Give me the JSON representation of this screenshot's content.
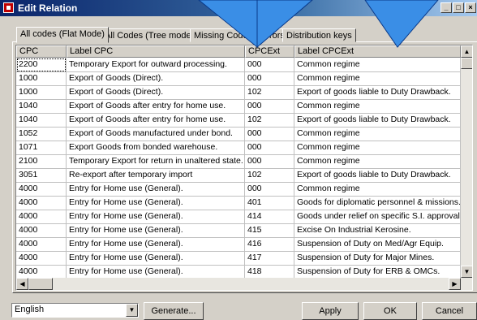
{
  "window": {
    "title": "Edit Relation",
    "icon": "app-flag-icon"
  },
  "tabs": [
    {
      "label": "All codes (Flat Mode)",
      "active": true
    },
    {
      "label": "All Codes (Tree mode)",
      "active": false
    },
    {
      "label": "Missing Codes",
      "active": false
    },
    {
      "label": "Errors",
      "active": false
    },
    {
      "label": "Distribution keys",
      "active": false
    }
  ],
  "grid": {
    "columns": [
      "CPC",
      "Label CPC",
      "CPCExt",
      "Label CPCExt"
    ],
    "rows": [
      [
        "2200",
        "Temporary Export for outward  processing.",
        "000",
        "Common regime"
      ],
      [
        "1000",
        "Export of Goods (Direct).",
        "000",
        "Common regime"
      ],
      [
        "1000",
        "Export of Goods (Direct).",
        "102",
        "Export of goods liable to Duty Drawback."
      ],
      [
        "1040",
        "Export of Goods after entry for home use.",
        "000",
        "Common regime"
      ],
      [
        "1040",
        "Export of Goods after entry for home use.",
        "102",
        "Export of goods liable to Duty Drawback."
      ],
      [
        "1052",
        "Export of Goods manufactured under bond.",
        "000",
        "Common regime"
      ],
      [
        "1071",
        "Export Goods from bonded warehouse.",
        "000",
        "Common regime"
      ],
      [
        "2100",
        "Temporary Export for return in unaltered state.",
        "000",
        "Common regime"
      ],
      [
        "3051",
        "Re-export after temporary import",
        "102",
        "Export of goods liable to Duty Drawback."
      ],
      [
        "4000",
        "Entry for Home use (General).",
        "000",
        "Common regime"
      ],
      [
        "4000",
        "Entry for Home use (General).",
        "401",
        "Goods for diplomatic personnel & missions."
      ],
      [
        "4000",
        "Entry for Home use (General).",
        "414",
        "Goods under relief on specific S.I. approval by"
      ],
      [
        "4000",
        "Entry for Home use (General).",
        "415",
        "Excise On Industrial Kerosine."
      ],
      [
        "4000",
        "Entry for Home use (General).",
        "416",
        "Suspension of Duty on Med/Agr Equip."
      ],
      [
        "4000",
        "Entry for Home use (General).",
        "417",
        "Suspension of Duty  for Major Mines."
      ],
      [
        "4000",
        "Entry for Home use (General).",
        "418",
        "Suspension of Duty for ERB & OMCs."
      ]
    ]
  },
  "footer": {
    "language": "English",
    "generate_label": "Generate...",
    "apply_label": "Apply",
    "ok_label": "OK",
    "cancel_label": "Cancel"
  },
  "colors": {
    "title_bar": "#0a246a",
    "overlay_arrows": "#3a8ee6"
  }
}
